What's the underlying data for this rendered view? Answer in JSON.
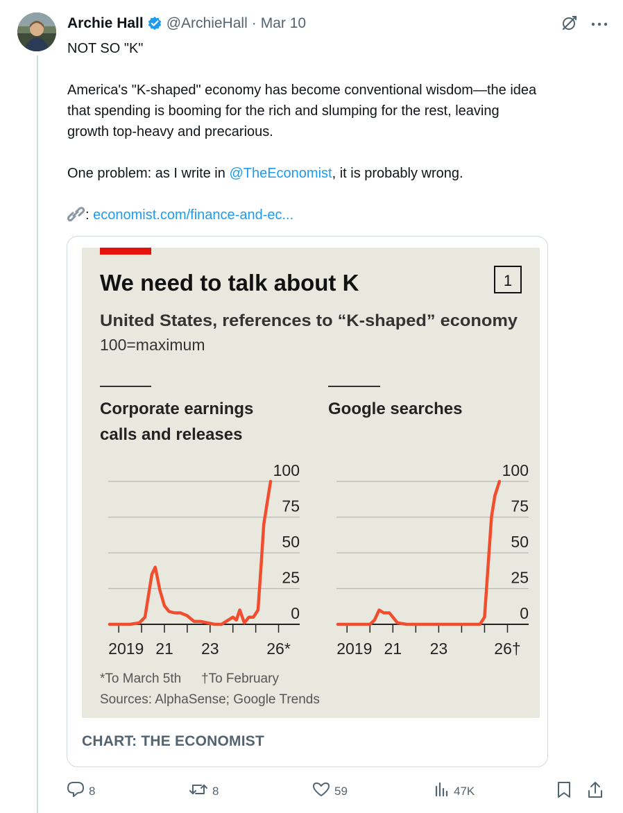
{
  "author": {
    "name": "Archie Hall",
    "handle": "@ArchieHall",
    "separator": "·",
    "date": "Mar 10"
  },
  "tweet": {
    "headline": "NOT SO \"K\"",
    "paragraph1_line1": "America's \"K-shaped\" economy has become conventional wisdom—the idea",
    "paragraph1_line2": "that spending is booming for the rich and slumping for the rest, leaving",
    "paragraph1_line3": "growth top-heavy and precarious.",
    "paragraph2_prefix": "One problem: as I write in ",
    "paragraph2_mention": "@TheEconomist",
    "paragraph2_suffix": ", it is probably wrong.",
    "link_emoji": "🔗",
    "link_colon": ":",
    "link_text": "economist.com/finance-and-ec..."
  },
  "card": {
    "caption": "CHART: THE ECONOMIST"
  },
  "actions": {
    "replies": "8",
    "reposts": "8",
    "likes": "59",
    "views": "47K"
  },
  "colors": {
    "accent_red": "#e3120b",
    "line_red": "#f04e2f",
    "chart_bg": "#e9e8df",
    "link_blue": "#1d9bf0",
    "muted": "#536471"
  },
  "chart_data": [
    {
      "type": "line",
      "title": "We need to talk about K",
      "chart_number": "1",
      "subtitle": "United States, references to “K-shaped” economy",
      "units": "100=maximum",
      "panel_title_line1": "Corporate earnings",
      "panel_title_line2": "calls and releases",
      "ylim": [
        0,
        100
      ],
      "yticks": [
        "100",
        "75",
        "50",
        "25",
        "0"
      ],
      "xlim": [
        2018.6,
        2026.5
      ],
      "xtick_labels": [
        "2019",
        "21",
        "23",
        "26*"
      ],
      "grid": true,
      "x": [
        2018.6,
        2019.0,
        2019.5,
        2019.9,
        2020.15,
        2020.3,
        2020.45,
        2020.6,
        2020.8,
        2021.0,
        2021.2,
        2021.45,
        2021.7,
        2022.0,
        2022.3,
        2022.6,
        2022.9,
        2023.2,
        2023.5,
        2023.8,
        2024.0,
        2024.15,
        2024.3,
        2024.5,
        2024.7,
        2024.9,
        2025.1,
        2025.25,
        2025.35,
        2025.5,
        2025.65
      ],
      "values": [
        0,
        0,
        0,
        1,
        5,
        20,
        35,
        40,
        24,
        13,
        9,
        8,
        8,
        6,
        2,
        2,
        1,
        0,
        0,
        3,
        5,
        3,
        10,
        1,
        5,
        5,
        10,
        45,
        70,
        85,
        100
      ],
      "series": [
        {
          "values_ref": "values"
        }
      ]
    },
    {
      "type": "line",
      "panel_title": "Google searches",
      "ylim": [
        0,
        100
      ],
      "yticks": [
        "100",
        "75",
        "50",
        "25",
        "0"
      ],
      "xlim": [
        2018.6,
        2026.5
      ],
      "xtick_labels": [
        "2019",
        "21",
        "23",
        "26†"
      ],
      "grid": true,
      "x": [
        2018.6,
        2019.5,
        2020.0,
        2020.2,
        2020.4,
        2020.6,
        2020.85,
        2021.2,
        2021.6,
        2022.0,
        2023.0,
        2024.0,
        2024.8,
        2025.0,
        2025.15,
        2025.3,
        2025.45,
        2025.65
      ],
      "values": [
        0,
        0,
        0,
        3,
        10,
        8,
        8,
        1,
        0,
        0,
        0,
        0,
        0,
        5,
        40,
        75,
        90,
        100
      ]
    }
  ],
  "chart_footer": {
    "footnote_a": "*To March 5th",
    "footnote_b": "†To February",
    "sources": "Sources: AlphaSense; Google Trends"
  }
}
